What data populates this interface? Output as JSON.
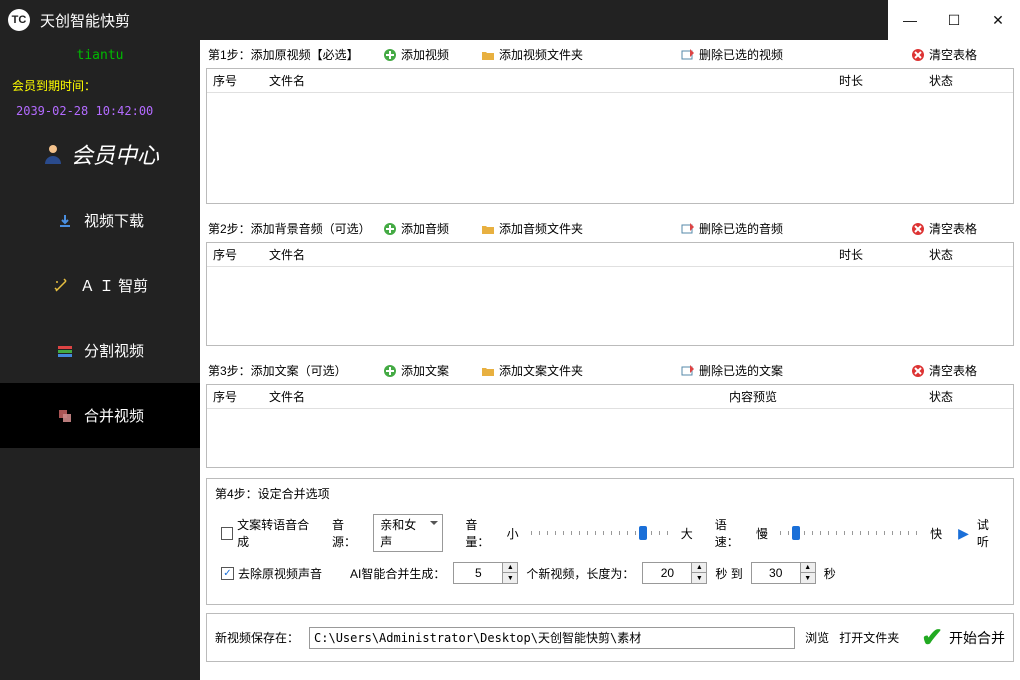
{
  "window": {
    "title": "天创智能快剪"
  },
  "sidebar": {
    "username": "tiantu",
    "expiry_label": "会员到期时间：",
    "expiry_value": "2039-02-28 10:42:00",
    "member_center": "会员中心",
    "nav": [
      {
        "label": "视频下载"
      },
      {
        "label": "Ａ Ｉ 智剪"
      },
      {
        "label": "分割视频"
      },
      {
        "label": "合并视频"
      }
    ]
  },
  "step1": {
    "label": "第1步：添加原视频【必选】",
    "add": "添加视频",
    "folder": "添加视频文件夹",
    "del": "删除已选的视频",
    "clear": "清空表格",
    "cols": {
      "seq": "序号",
      "name": "文件名",
      "dur": "时长",
      "stat": "状态"
    }
  },
  "step2": {
    "label": "第2步：添加背景音频（可选）",
    "add": "添加音频",
    "folder": "添加音频文件夹",
    "del": "删除已选的音频",
    "clear": "清空表格",
    "cols": {
      "seq": "序号",
      "name": "文件名",
      "dur": "时长",
      "stat": "状态"
    }
  },
  "step3": {
    "label": "第3步：添加文案（可选）",
    "add": "添加文案",
    "folder": "添加文案文件夹",
    "del": "删除已选的文案",
    "clear": "清空表格",
    "cols": {
      "seq": "序号",
      "name": "文件名",
      "preview": "内容预览",
      "stat": "状态"
    }
  },
  "step4": {
    "label": "第4步：设定合并选项",
    "tts": "文案转语音合成",
    "voice_label": "音源：",
    "voice_value": "亲和女声",
    "vol_label": "音量：",
    "vol_low": "小",
    "vol_high": "大",
    "speed_label": "语速：",
    "speed_low": "慢",
    "speed_high": "快",
    "preview": "试听",
    "remove_audio": "去除原视频声音",
    "ai_gen_label": "AI智能合并生成：",
    "count": "5",
    "count_suffix": "个新视频，长度为：",
    "min": "20",
    "mid": "秒 到",
    "max": "30",
    "max_suffix": "秒"
  },
  "save": {
    "label": "新视频保存在：",
    "path": "C:\\Users\\Administrator\\Desktop\\天创智能快剪\\素材",
    "browse": "浏览",
    "open": "打开文件夹",
    "start": "开始合并"
  }
}
